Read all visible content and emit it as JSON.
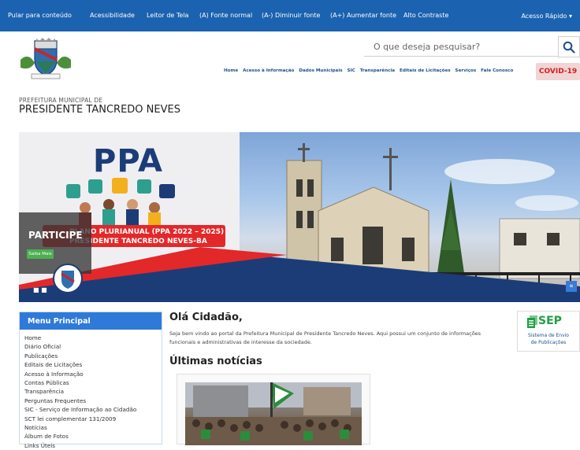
{
  "accessibility_bar": {
    "skip_label": "Pular para conteúdo",
    "accessibility_label": "Acessibilidade",
    "screen_reader_label": "Leitor de Tela",
    "font_normal_label": "(A) Fonte normal",
    "font_decrease_label": "(A-) Diminuir fonte",
    "font_increase_label": "(A+) Aumentar fonte",
    "contrast_label": "Alto Contraste",
    "quick_access_label": "Acesso Rápido",
    "color": "#1b62b0"
  },
  "header": {
    "search_placeholder": "O que deseja pesquisar?",
    "nav": [
      "Home",
      "Acesso à Informação",
      "Dados Municipais",
      "SIC",
      "Transparência",
      "Editais de Licitações",
      "Serviços",
      "Fale Conosco"
    ],
    "covid_label": "COVID-19",
    "prefecture_label": "PREFEITURA MUNICIPAL DE",
    "prefecture_name": "PRESIDENTE TANCREDO NEVES"
  },
  "banner": {
    "ppa_text": "PPA",
    "plan_line1": "PLANO PLURIANUAL (PPA 2022 – 2025)",
    "plan_line2": "PRESIDENTE TANCREDO NEVES-BA",
    "slide_title": "PARTICIPE",
    "slide_button": "Saiba Mais",
    "slide_dots": "■ ■",
    "prev_glyph": "«"
  },
  "menu": {
    "title": "Menu Principal",
    "items": [
      "Home",
      "Diário Oficial",
      "Publicações",
      "Editais de Licitações",
      "Acesso à Informação",
      "Contas Públicas",
      "Transparência",
      "Perguntas Frequentes",
      "SIC - Serviço de Informação ao Cidadão",
      "SCT lei complementar 131/2009",
      "Notícias",
      "Álbum de Fotos",
      "Links Úteis"
    ],
    "accent": "#2f7ad9"
  },
  "content": {
    "greeting": "Olá Cidadão,",
    "welcome_text": "Seja bem vindo ao portal da Prefeitura Municipal de Presidente Tancredo Neves. Aqui possui um conjunto de informações funcionais e administrativas de interesse da sociedade.",
    "news_heading": "Últimas notícias"
  },
  "sep": {
    "title": "SEP",
    "subtitle_line1": "Sistema de Envio",
    "subtitle_line2": "de Publicações",
    "color": "#1ea043"
  }
}
